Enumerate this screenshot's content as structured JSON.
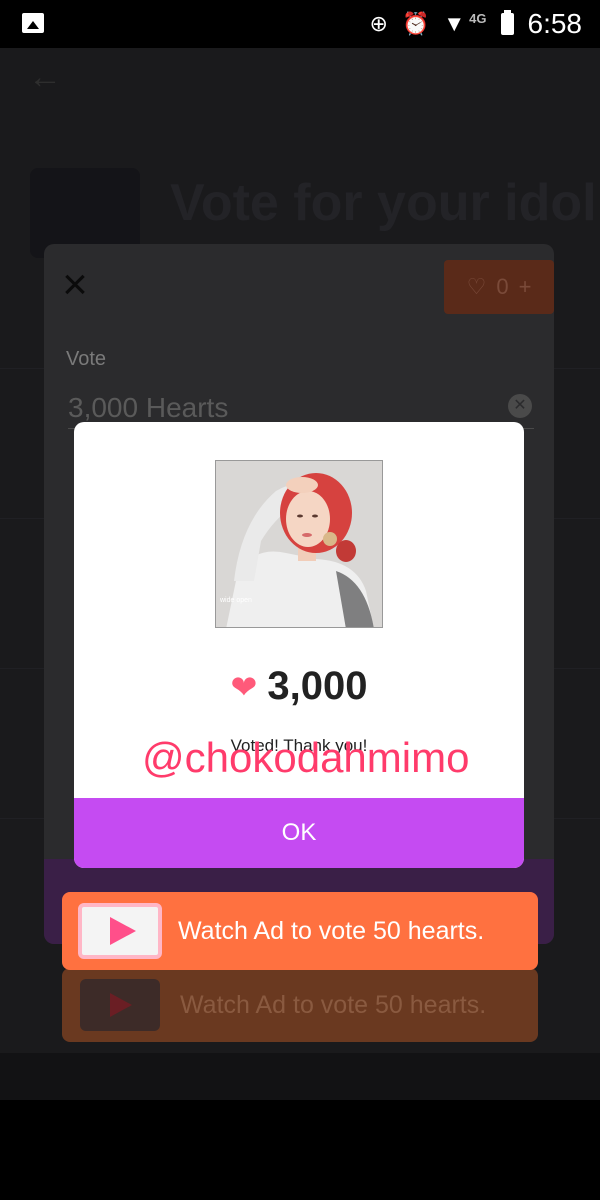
{
  "status_bar": {
    "network": "4G",
    "time": "6:58"
  },
  "background": {
    "banner_line1": "",
    "banner_line2": "",
    "banner_title": "Vote for your idol"
  },
  "vote_sheet": {
    "hearts_balance": "0",
    "plus": "+",
    "vote_label": "Vote",
    "vote_amount": "3,000 Hearts"
  },
  "dialog": {
    "hearts_count": "3,000",
    "message": "Voted! Thank you!",
    "ok_label": "OK",
    "photo_caption": "wide open"
  },
  "watermark": "@chokodahmimo",
  "ad_button": {
    "label": "Watch Ad to vote 50 hearts."
  },
  "colors": {
    "ok_purple": "#c54bf2",
    "ad_orange": "#ff7140",
    "heart_pink": "#ff5a7a",
    "watermark_red": "#ff3b6b"
  }
}
